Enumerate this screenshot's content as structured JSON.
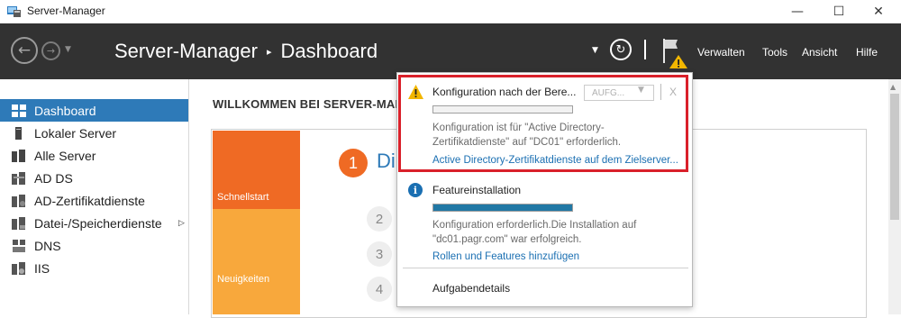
{
  "window": {
    "title": "Server-Manager",
    "minimize": "—",
    "maximize": "☐",
    "close": "✕"
  },
  "header": {
    "breadcrumb_root": "Server-Manager",
    "breadcrumb_sep": "▸",
    "breadcrumb_page": "Dashboard",
    "menu": [
      "Verwalten",
      "Tools",
      "Ansicht",
      "Hilfe"
    ]
  },
  "sidebar": {
    "items": [
      {
        "label": "Dashboard",
        "icon": "dashboard-icon",
        "active": true
      },
      {
        "label": "Lokaler Server",
        "icon": "server-icon"
      },
      {
        "label": "Alle Server",
        "icon": "servers-icon"
      },
      {
        "label": "AD DS",
        "icon": "ad-ds-icon"
      },
      {
        "label": "AD-Zertifikatdienste",
        "icon": "certificate-services-icon"
      },
      {
        "label": "Datei-/Speicherdienste",
        "icon": "file-storage-icon",
        "has_submenu": true
      },
      {
        "label": "DNS",
        "icon": "dns-icon"
      },
      {
        "label": "IIS",
        "icon": "iis-icon"
      }
    ]
  },
  "main": {
    "welcome": "WILLKOMMEN BEI SERVER-MAN",
    "tiles": {
      "quickstart": "Schnellstart",
      "news": "Neuigkeiten"
    },
    "step1_number": "1",
    "step1_title": "Di",
    "steps": [
      "2",
      "3",
      "4"
    ]
  },
  "notifications": {
    "item1": {
      "title": "Konfiguration nach der Bere...",
      "task_button": "AUFG...",
      "close": "X",
      "progress": 0,
      "desc_line1": "Konfiguration ist für \"Active Directory-",
      "desc_line2": "Zertifikatdienste\" auf \"DC01\" erforderlich.",
      "link": "Active Directory-Zertifikatdienste auf dem Zielserver..."
    },
    "item2": {
      "title": "Featureinstallation",
      "progress": 1.0,
      "desc_line1": "Konfiguration erforderlich.Die Installation auf",
      "desc_line2": "\"dc01.pagr.com\" war erfolgreich.",
      "link": "Rollen und Features hinzufügen"
    },
    "task_details": "Aufgabendetails"
  },
  "colors": {
    "header_bg": "#323232",
    "accent_blue": "#2e7ab8",
    "highlight_red": "#d9202a",
    "orange": "#ef6a24",
    "amber": "#f8a83c",
    "warning_yellow": "#f2b600"
  }
}
